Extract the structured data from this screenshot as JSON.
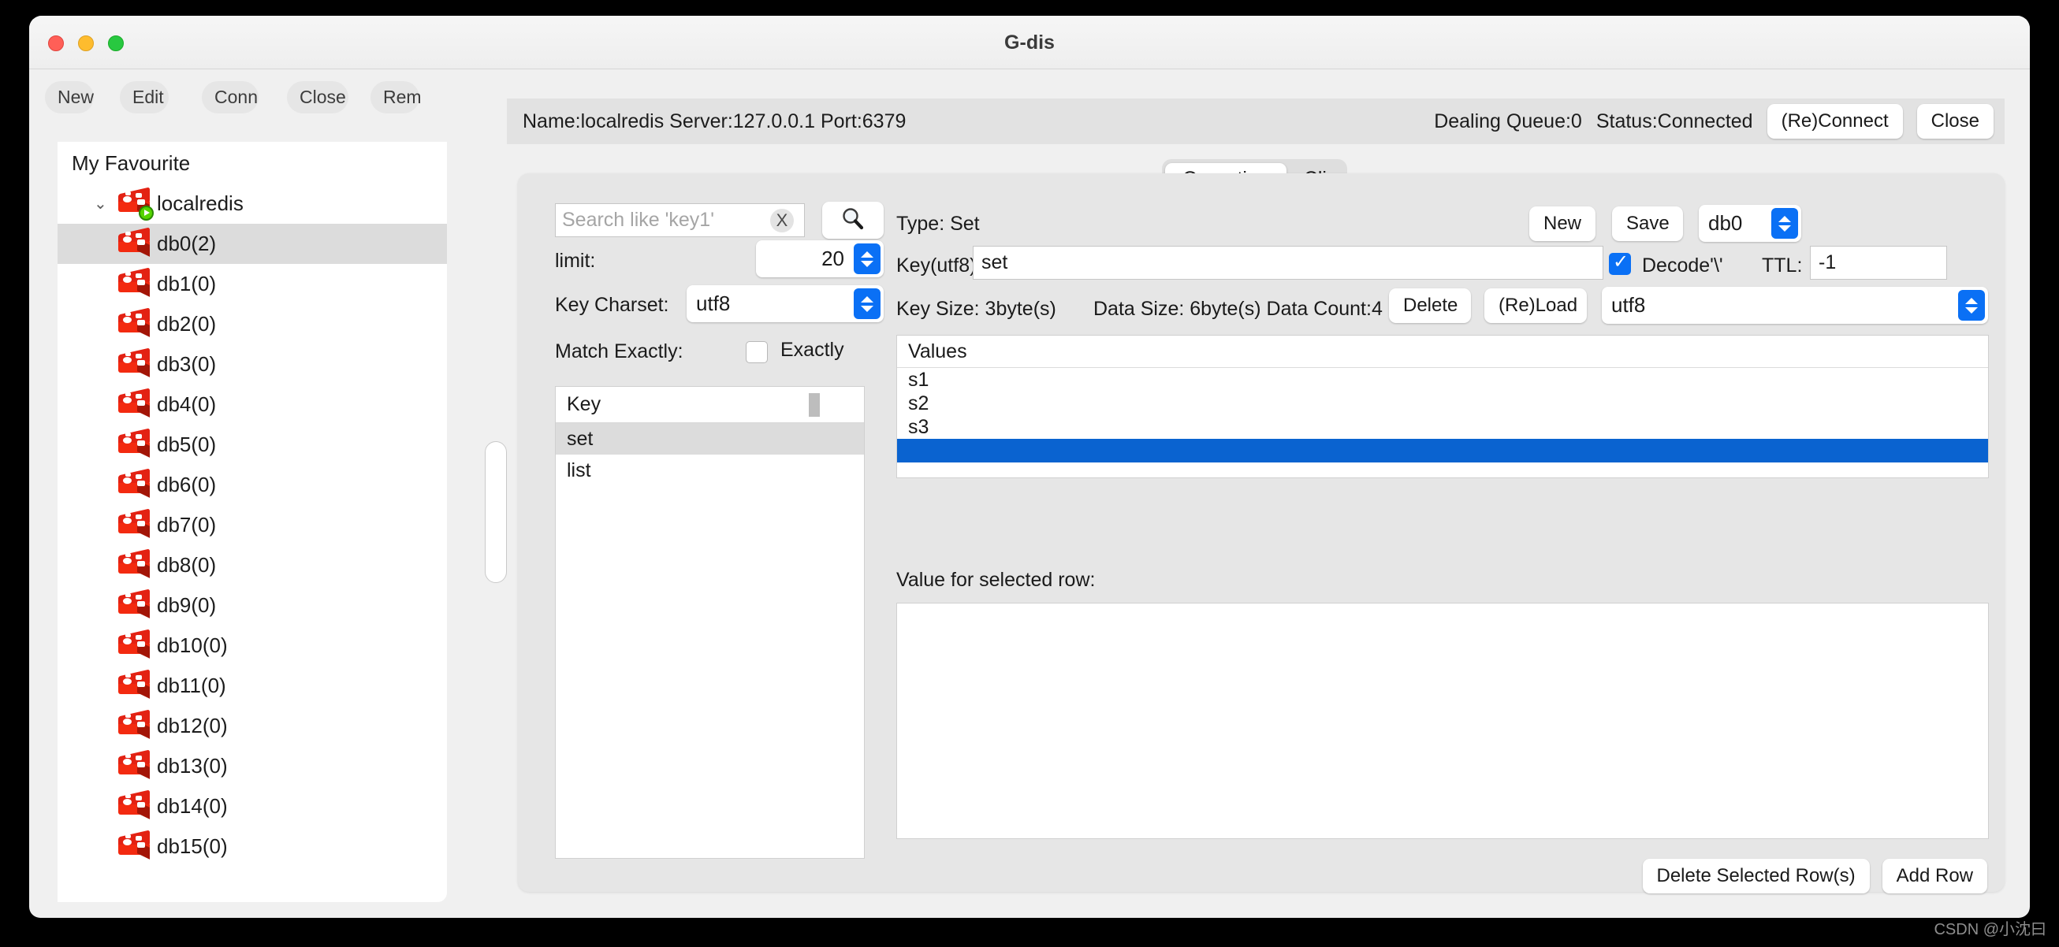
{
  "window": {
    "title": "G-dis",
    "traffic_lights": [
      "close",
      "minimize",
      "zoom"
    ]
  },
  "toolbar": {
    "buttons": [
      {
        "label": "New",
        "name": "new-connection-button"
      },
      {
        "label": "Edit",
        "name": "edit-connection-button"
      },
      {
        "label": "Conn",
        "name": "connect-button"
      },
      {
        "label": "Close",
        "name": "close-connection-button"
      },
      {
        "label": "Rem",
        "name": "remove-connection-button"
      }
    ]
  },
  "sidebar": {
    "root_label": "My Favourite",
    "server": {
      "label": "localredis",
      "expanded": true,
      "running": true
    },
    "databases": [
      {
        "label": "db0(2)",
        "selected": true
      },
      {
        "label": "db1(0)",
        "selected": false
      },
      {
        "label": "db2(0)",
        "selected": false
      },
      {
        "label": "db3(0)",
        "selected": false
      },
      {
        "label": "db4(0)",
        "selected": false
      },
      {
        "label": "db5(0)",
        "selected": false
      },
      {
        "label": "db6(0)",
        "selected": false
      },
      {
        "label": "db7(0)",
        "selected": false
      },
      {
        "label": "db8(0)",
        "selected": false
      },
      {
        "label": "db9(0)",
        "selected": false
      },
      {
        "label": "db10(0)",
        "selected": false
      },
      {
        "label": "db11(0)",
        "selected": false
      },
      {
        "label": "db12(0)",
        "selected": false
      },
      {
        "label": "db13(0)",
        "selected": false
      },
      {
        "label": "db14(0)",
        "selected": false
      },
      {
        "label": "db15(0)",
        "selected": false
      }
    ]
  },
  "connection_bar": {
    "info": "Name:localredis Server:127.0.0.1 Port:6379",
    "dealing_queue": "Dealing Queue:0",
    "status": "Status:Connected",
    "reconnect_label": "(Re)Connect",
    "close_label": "Close"
  },
  "tabs": [
    {
      "label": "Operation",
      "active": true
    },
    {
      "label": "Cli",
      "active": false
    }
  ],
  "filter": {
    "search_placeholder": "Search like 'key1'",
    "search_value": "",
    "clear_label": "X",
    "search_icon": "magnifier-icon",
    "limit_label": "limit:",
    "limit_value": "20",
    "charset_label": "Key Charset:",
    "charset_value": "utf8",
    "match_label": "Match Exactly:",
    "exactly_label": "Exactly",
    "exactly_checked": false
  },
  "key_table": {
    "column": "Key",
    "rows": [
      {
        "key": "set",
        "selected": true
      },
      {
        "key": "list",
        "selected": false
      }
    ]
  },
  "detail": {
    "type_label": "Type: Set",
    "new_label": "New",
    "save_label": "Save",
    "db_value": "db0",
    "key_label": "Key(utf8):",
    "key_value": "set",
    "decode_label": "Decode'\\'",
    "decode_checked": true,
    "ttl_label": "TTL:",
    "ttl_value": "-1",
    "key_size_label": "Key Size: 3byte(s)",
    "data_size_label": "Data Size: 6byte(s) Data Count:4",
    "delete_label": "Delete",
    "reload_label": "(Re)Load",
    "value_charset": "utf8"
  },
  "values_table": {
    "column": "Values",
    "rows": [
      {
        "value": "s1",
        "selected": false
      },
      {
        "value": "s2",
        "selected": false
      },
      {
        "value": "s3",
        "selected": false
      },
      {
        "value": "",
        "selected": true
      }
    ]
  },
  "value_panel": {
    "label": "Value for selected row:",
    "text": ""
  },
  "bottom_actions": {
    "delete_rows_label": "Delete Selected Row(s)",
    "add_row_label": "Add Row"
  },
  "watermark": "CSDN @小沈曰",
  "colors": {
    "accent_blue": "#0a70f5",
    "selection_blue": "#0a63d0",
    "redis_red": "#e32213",
    "running_green": "#55d400"
  }
}
